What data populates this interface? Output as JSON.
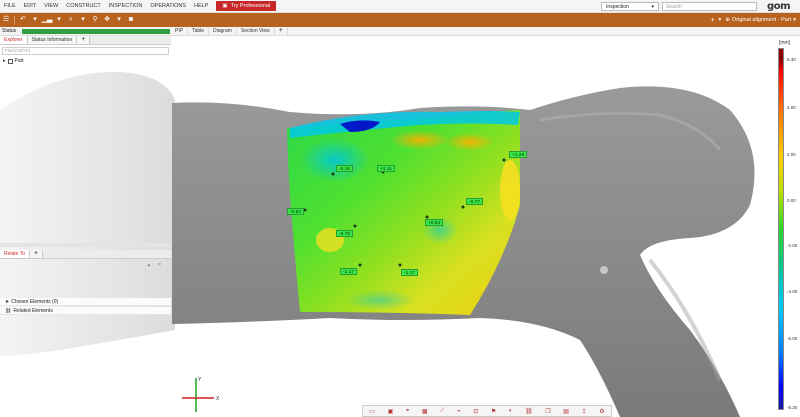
{
  "menu": {
    "items": [
      "FILE",
      "EDIT",
      "VIEW",
      "CONSTRUCT",
      "INSPECTION",
      "OPERATIONS",
      "HELP"
    ],
    "try_pro": "Try Professional",
    "workspace": "Inspection",
    "search_placeholder": "Search",
    "logo": "gom"
  },
  "toolbar": {
    "alignment_label": "Original alignment - Part"
  },
  "left_panel": {
    "status_label": "Status",
    "tabs": [
      "Explorer",
      "Status Information"
    ],
    "find_placeholder": "Find (Ctrl+F)",
    "tree_root": "Part",
    "related_tab": "Relate To",
    "rel_rows": [
      "Chosen Elements (0)",
      "Related Elements"
    ]
  },
  "view_tabs": [
    "PIP",
    "Table",
    "Diagram",
    "Section View"
  ],
  "legend": {
    "unit": "[mm]",
    "ticks": [
      "6.30",
      "4.00",
      "2.00",
      "0.00",
      "-2.00",
      "-4.00",
      "-6.00",
      "-8.30"
    ]
  },
  "labels": [
    {
      "text": "+1.29"
    },
    {
      "text": "-0.16"
    },
    {
      "text": "+1.11"
    },
    {
      "text": "-0.93"
    },
    {
      "text": "-0.77"
    },
    {
      "text": "+0.62"
    },
    {
      "text": "-0.79"
    },
    {
      "text": "-1.17"
    },
    {
      "text": "-1.17"
    }
  ],
  "axis": {
    "x_label": "X",
    "y_label": "Y"
  },
  "colors": {
    "accent": "#b8621f",
    "try_pro": "#c62828",
    "status_green": "#2ea043"
  }
}
